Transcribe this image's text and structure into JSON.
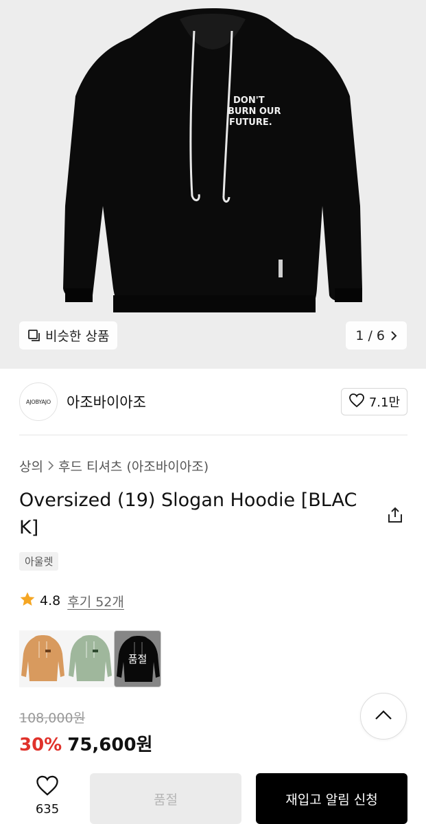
{
  "hero": {
    "hoodie_print_text": [
      "DON'T",
      "BURN OUR",
      "FUTURE."
    ],
    "similar_label": "비슷한 상품",
    "counter": "1 / 6"
  },
  "brand": {
    "logo_text": "AJOBYAJO",
    "name": "아조바이아조",
    "like_count": "7.1만"
  },
  "breadcrumb": {
    "category": "상의",
    "subcategory": "후드 티셔츠 (아조바이아조)"
  },
  "product": {
    "title": "Oversized (19) Slogan Hoodie [BLACK]",
    "tag": "아울렛",
    "rating": "4.8",
    "reviews": "후기 52개"
  },
  "colors": {
    "options": [
      {
        "name": "orange",
        "color": "#d89a5e"
      },
      {
        "name": "mint",
        "color": "#9fb79c"
      },
      {
        "name": "black",
        "color": "#111111",
        "badge": "품절"
      }
    ]
  },
  "price": {
    "original": "108,000원",
    "discount": "30%",
    "final": "75,600원"
  },
  "bottom": {
    "like_count": "635",
    "soldout_label": "품절",
    "restock_label": "재입고 알림 신청"
  },
  "theme": {
    "accent_red": "#e0322b",
    "star": "#f5a623"
  }
}
